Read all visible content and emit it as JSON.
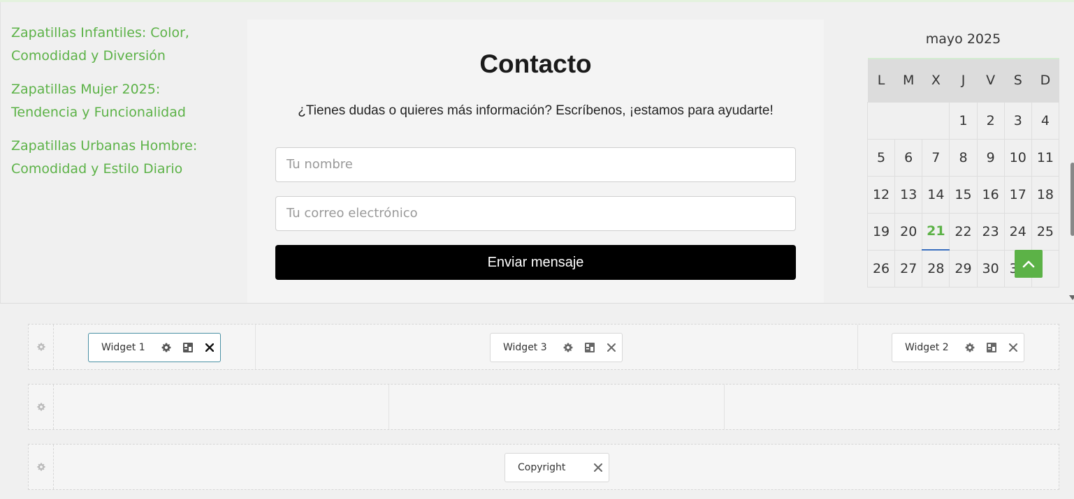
{
  "sidebar": {
    "posts": [
      {
        "line1": "Zapatillas Infantiles: Color,",
        "line2": "Comodidad y Diversión"
      },
      {
        "line1": "Zapatillas Mujer 2025:",
        "line2": "Tendencia y Funcionalidad"
      },
      {
        "line1": "Zapatillas Urbanas Hombre:",
        "line2": "Comodidad y Estilo Diario"
      }
    ]
  },
  "contact": {
    "title": "Contacto",
    "intro": "¿Tienes dudas o quieres más información? Escríbenos, ¡estamos para ayudarte!",
    "name_placeholder": "Tu nombre",
    "email_placeholder": "Tu correo electrónico",
    "submit_label": "Enviar mensaje"
  },
  "calendar": {
    "caption": "mayo 2025",
    "weekdays": [
      "L",
      "M",
      "X",
      "J",
      "V",
      "S",
      "D"
    ],
    "weeks": [
      [
        "",
        "",
        "",
        "1",
        "2",
        "3",
        "4"
      ],
      [
        "5",
        "6",
        "7",
        "8",
        "9",
        "10",
        "11"
      ],
      [
        "12",
        "13",
        "14",
        "15",
        "16",
        "17",
        "18"
      ],
      [
        "19",
        "20",
        "21",
        "22",
        "23",
        "24",
        "25"
      ],
      [
        "26",
        "27",
        "28",
        "29",
        "30",
        "31",
        ""
      ]
    ],
    "today": "21"
  },
  "builder": {
    "row1": {
      "widget1": "Widget 1",
      "widget3": "Widget 3",
      "widget2": "Widget 2"
    },
    "row3": {
      "copyright": "Copyright"
    }
  },
  "colors": {
    "accent_green": "#5cb247",
    "button_black": "#000000",
    "active_widget_border": "#4a90a4"
  },
  "icons": [
    "gear-icon",
    "layout-icon",
    "close-icon",
    "chevron-up-icon"
  ]
}
